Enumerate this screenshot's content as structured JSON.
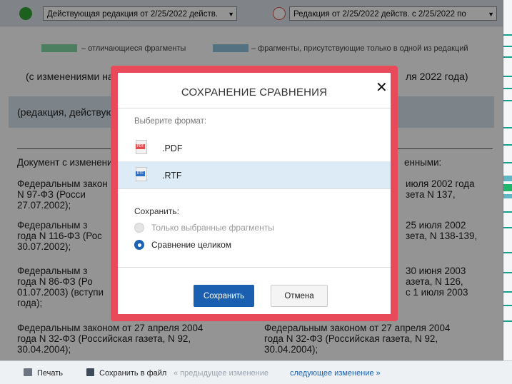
{
  "toolbar": {
    "left_select": "Действующая редакция от 2/25/2022 действ.",
    "right_select": "Редакция от 2/25/2022 действ. с 2/25/2022 по"
  },
  "legend": {
    "changed_label": "– отличающиеся фрагменты",
    "unique_label": "– фрагменты, присутствующие только в одной из редакций",
    "changed_color": "#83d9a6",
    "unique_color": "#8fc3df"
  },
  "document": {
    "line_with_changes": "(с изменениями на",
    "line_with_changes_right": "ля 2022 года)",
    "edition_line": "(редакция, действую",
    "left_heading": "Документ с изменени",
    "right_heading": "енными:",
    "left_paragraphs": [
      "Федеральным закон\nN 97-ФЗ (Росси\n27.07.2002);",
      "Федеральным з\nгода N 116-ФЗ (Рос\n30.07.2002);",
      "Федеральным з\nгода N 86-ФЗ (Ро\n01.07.2003) (вступи\nгода);",
      "Федеральным законом от 27 апреля 2004\nгода N 32-ФЗ (Российская газета, N 92,\n30.04.2004);"
    ],
    "right_paragraphs": [
      "июля 2002 года\nзета N 137,",
      "25 июля 2002\nзета, N 138-139,",
      "30 июня 2003\nазета, N 126,\nс 1 июля 2003",
      "Федеральным законом от 27 апреля 2004\nгода N 32-ФЗ (Российская газета, N 92,\n30.04.2004);"
    ]
  },
  "modal": {
    "title": "СОХРАНЕНИЕ СРАВНЕНИЯ",
    "choose_format": "Выберите формат:",
    "formats": [
      {
        "label": ".PDF",
        "icon": "pdf-file-icon",
        "tag": "PDF",
        "tag_color": "#e04e4e",
        "selected": false
      },
      {
        "label": ".RTF",
        "icon": "rtf-file-icon",
        "tag": "RTF",
        "tag_color": "#2d6fc5",
        "selected": true
      }
    ],
    "save_label": "Сохранить:",
    "options": [
      {
        "label": "Только выбранные фрагменты",
        "checked": false,
        "enabled": false
      },
      {
        "label": "Сравнение целиком",
        "checked": true,
        "enabled": true
      }
    ],
    "save_button": "Сохранить",
    "cancel_button": "Отмена"
  },
  "bottombar": {
    "print": "Печать",
    "save_to_file": "Сохранить в файл",
    "prev_change": "« предыдущее изменение",
    "next_change": "следующее изменение »"
  }
}
